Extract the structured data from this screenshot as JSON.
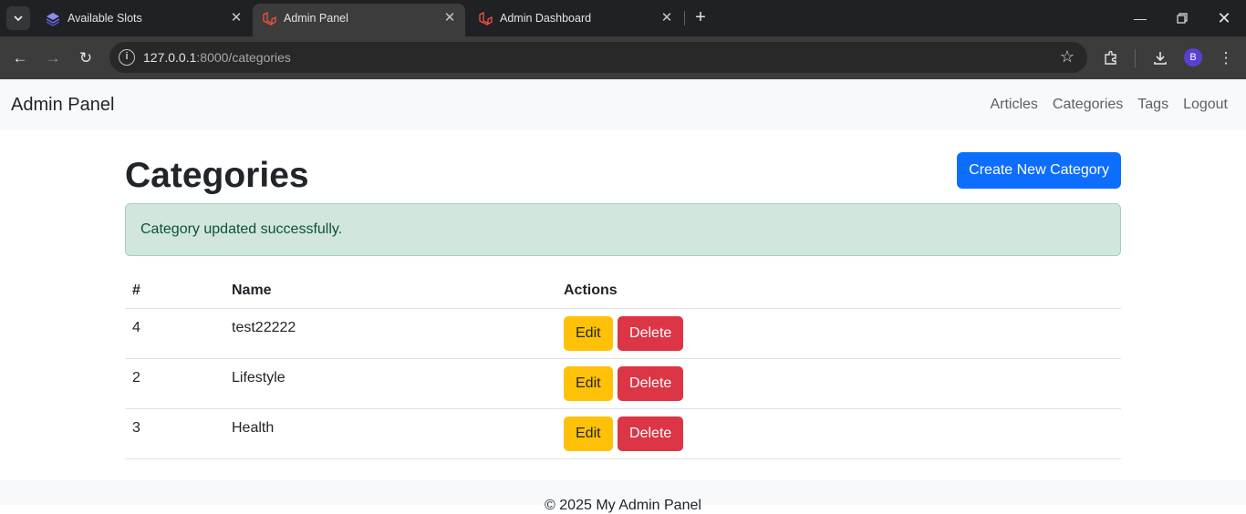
{
  "browser": {
    "tabs": [
      {
        "title": "Available Slots",
        "favicon": "layers-icon"
      },
      {
        "title": "Admin Panel",
        "favicon": "laravel-icon"
      },
      {
        "title": "Admin Dashboard",
        "favicon": "laravel-icon"
      }
    ],
    "active_tab": 1,
    "url_host": "127.0.0.1",
    "url_rest": ":8000/categories",
    "profile_initial": "B"
  },
  "navbar": {
    "brand": "Admin Panel",
    "links": [
      "Articles",
      "Categories",
      "Tags",
      "Logout"
    ]
  },
  "main": {
    "title": "Categories",
    "create_button": "Create New Category",
    "alert": "Category updated successfully.",
    "table": {
      "headers": [
        "#",
        "Name",
        "Actions"
      ],
      "rows": [
        {
          "id": "4",
          "name": "test22222"
        },
        {
          "id": "2",
          "name": "Lifestyle"
        },
        {
          "id": "3",
          "name": "Health"
        }
      ],
      "edit_label": "Edit",
      "delete_label": "Delete"
    }
  },
  "footer": {
    "text": "© 2025 My Admin Panel"
  },
  "colors": {
    "primary": "#0d6efd",
    "warning": "#ffc107",
    "danger": "#dc3545",
    "success_bg": "#d1e7dd"
  }
}
